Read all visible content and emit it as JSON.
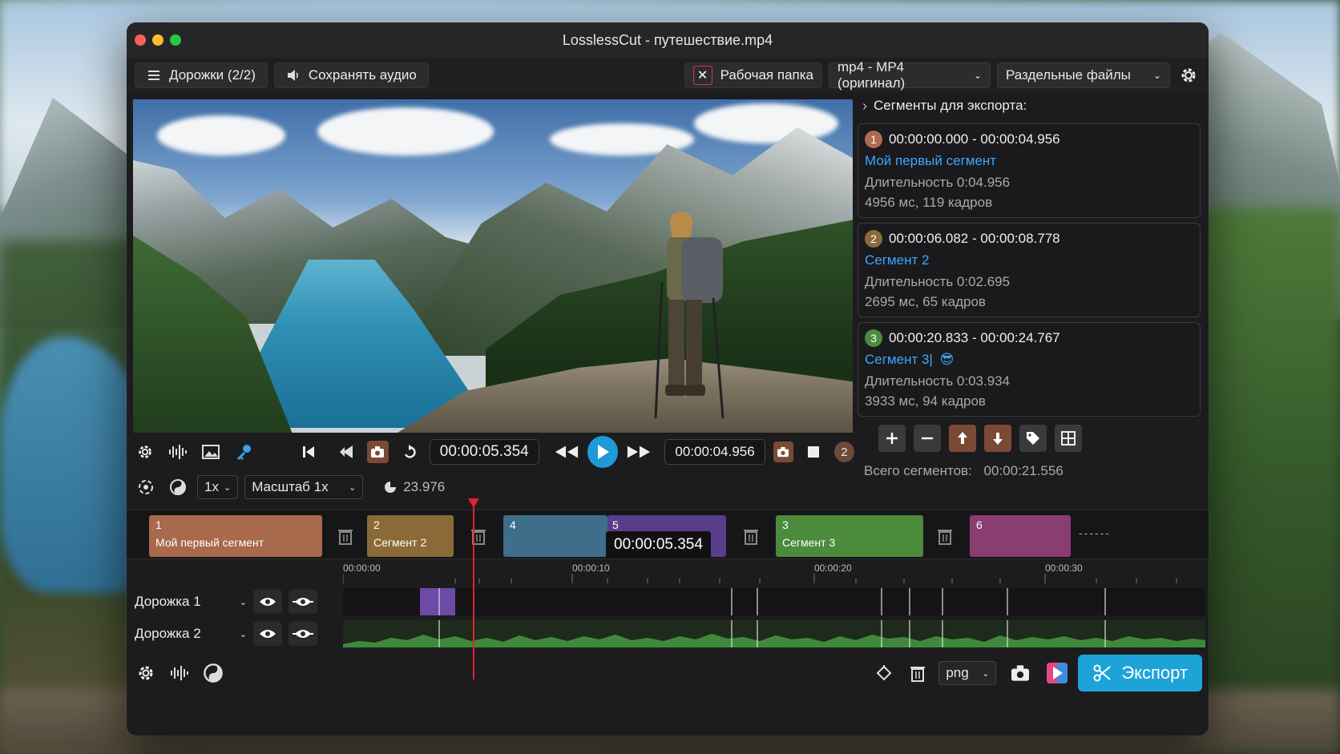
{
  "window": {
    "title": "LosslessCut - путешествие.mp4"
  },
  "toolbar": {
    "tracks_label": "Дорожки (2/2)",
    "keep_audio_label": "Сохранять аудио",
    "workdir_label": "Рабочая папка",
    "format_select": "mp4 - MP4 (оригинал)",
    "output_mode_select": "Раздельные файлы"
  },
  "side": {
    "header": "Сегменты для экспорта:",
    "segments": [
      {
        "num": "1",
        "color": "#b06a4d",
        "range": "00:00:00.000 - 00:00:04.956",
        "name": "Мой первый сегмент",
        "duration": "Длительность 0:04.956",
        "frames": "4956 мс, 119 кадров",
        "emoji": ""
      },
      {
        "num": "2",
        "color": "#8a6a3a",
        "range": "00:00:06.082 - 00:00:08.778",
        "name": "Сегмент 2",
        "duration": "Длительность 0:02.695",
        "frames": "2695 мс, 65 кадров",
        "emoji": ""
      },
      {
        "num": "3",
        "color": "#4e8a3e",
        "range": "00:00:20.833 - 00:00:24.767",
        "name": "Сегмент 3|",
        "duration": "Длительность 0:03.934",
        "frames": "3933 мс, 94 кадров",
        "emoji": "😎"
      }
    ],
    "total_label": "Всего сегментов:",
    "total_value": "00:00:21.556"
  },
  "controls": {
    "current_time": "00:00:05.354",
    "cut_time": "00:00:04.956",
    "segment_badge": "2",
    "speed": "1x",
    "zoom": "Масштаб 1x",
    "fps": "23.976"
  },
  "segbar": {
    "items": [
      {
        "n": "1",
        "label": "Мой первый сегмент",
        "color": "#a8694c"
      },
      {
        "n": "2",
        "label": "Сегмент 2",
        "color": "#8b6a38"
      },
      {
        "n": "4",
        "label": "",
        "color": "#3d6f8a"
      },
      {
        "n": "5",
        "label": "",
        "color": "#5a3d8a"
      },
      {
        "n": "3",
        "label": "Сегмент 3",
        "color": "#4c8a3c"
      },
      {
        "n": "6",
        "label": "",
        "color": "#8a3d70"
      }
    ],
    "tooltip_time": "00:00:05.354",
    "tail": "------"
  },
  "ruler": {
    "ticks": [
      "00:00:00",
      "00:00:10",
      "00:00:20",
      "00:00:30"
    ]
  },
  "tracks": [
    {
      "name": "Дорожка 1"
    },
    {
      "name": "Дорожка 2"
    }
  ],
  "bottom": {
    "image_format": "png",
    "export_label": "Экспорт"
  }
}
